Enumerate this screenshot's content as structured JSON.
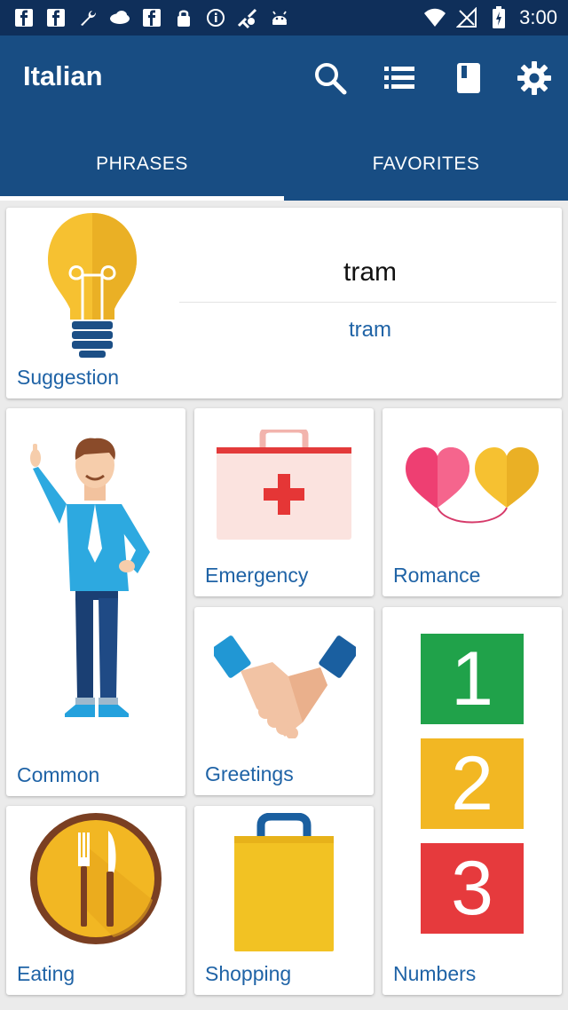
{
  "statusbar": {
    "time": "3:00",
    "left_icons": [
      "facebook-icon",
      "facebook-icon",
      "wrench-icon",
      "cloud-icon",
      "facebook-icon",
      "lock-icon",
      "info-icon",
      "fake-gps-icon",
      "android-icon"
    ],
    "right_icons": [
      "wifi-icon",
      "signal-icon",
      "battery-icon"
    ]
  },
  "appbar": {
    "title": "Italian",
    "actions": [
      "search-icon",
      "list-icon",
      "book-icon",
      "gear-icon"
    ],
    "color": "#184d83"
  },
  "tabs": [
    {
      "label": "PHRASES",
      "selected": true
    },
    {
      "label": "FAVORITES",
      "selected": false
    }
  ],
  "suggestion": {
    "label": "Suggestion",
    "word": "tram",
    "translation": "tram"
  },
  "categories": [
    {
      "label": "Common"
    },
    {
      "label": "Emergency"
    },
    {
      "label": "Romance"
    },
    {
      "label": "Greetings"
    },
    {
      "label": "Numbers",
      "digits": [
        "1",
        "2",
        "3"
      ]
    },
    {
      "label": "Eating"
    },
    {
      "label": "Shopping"
    }
  ]
}
